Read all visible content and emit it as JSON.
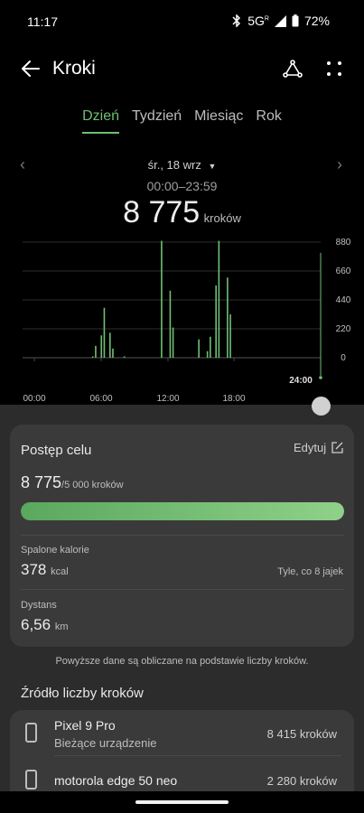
{
  "status_bar": {
    "time": "11:17",
    "network": "5G",
    "roaming": "R",
    "battery": "72%",
    "icons": [
      "bluetooth-icon",
      "signal-icon",
      "battery-icon"
    ]
  },
  "app_bar": {
    "title": "Kroki",
    "icons": [
      "back-arrow-icon",
      "share-icon",
      "more-icon"
    ]
  },
  "tabs": [
    {
      "label": "Dzień",
      "active": true
    },
    {
      "label": "Tydzień",
      "active": false
    },
    {
      "label": "Miesiąc",
      "active": false
    },
    {
      "label": "Rok",
      "active": false
    }
  ],
  "summary": {
    "date": "śr., 18 wrz",
    "time_range": "00:00–23:59",
    "steps": "8 775",
    "steps_unit": "kroków"
  },
  "chart_data": {
    "type": "bar",
    "x_ticks": [
      "00:00",
      "06:00",
      "12:00",
      "18:00",
      "24:00"
    ],
    "y_ticks": [
      "880",
      "660",
      "440",
      "220",
      "0"
    ],
    "ylim": [
      0,
      880
    ],
    "values": [
      0,
      0,
      0,
      0,
      0,
      0,
      0,
      0,
      0,
      0,
      0,
      0,
      0,
      0,
      0,
      0,
      0,
      0,
      0,
      0,
      0,
      0,
      0,
      0,
      10,
      90,
      0,
      170,
      380,
      0,
      190,
      70,
      0,
      0,
      0,
      10,
      0,
      0,
      0,
      0,
      0,
      0,
      0,
      0,
      0,
      0,
      0,
      0,
      890,
      0,
      0,
      510,
      230,
      0,
      0,
      0,
      0,
      0,
      0,
      0,
      0,
      140,
      0,
      0,
      50,
      160,
      0,
      550,
      890,
      0,
      0,
      610,
      330,
      0,
      0,
      0,
      0,
      0,
      0,
      0,
      0,
      0,
      0,
      0,
      0,
      0,
      0,
      0,
      0,
      0,
      0,
      0,
      0,
      0,
      0,
      0,
      0,
      0,
      0,
      0,
      0,
      0,
      0,
      0
    ],
    "bar_color": "#6fbf73",
    "grid": true
  },
  "goal_card": {
    "title": "Postęp celu",
    "edit_label": "Edytuj",
    "steps": "8 775",
    "goal": "/5 000 kroków",
    "progress": 1.0,
    "calories_label": "Spalone kalorie",
    "calories_value": "378",
    "calories_unit": "kcal",
    "calories_note": "Tyle, co 8 jajek",
    "distance_label": "Dystans",
    "distance_value": "6,56",
    "distance_unit": "km"
  },
  "footnote": "Powyższe dane są obliczane na podstawie liczby kroków.",
  "sources": {
    "title": "Źródło liczby kroków",
    "devices": [
      {
        "name": "Pixel 9 Pro",
        "subtitle": "Bieżące urządzenie",
        "steps": "8 415 kroków"
      },
      {
        "name": "motorola edge 50 neo",
        "subtitle": "",
        "steps": "2 280 kroków"
      }
    ]
  }
}
